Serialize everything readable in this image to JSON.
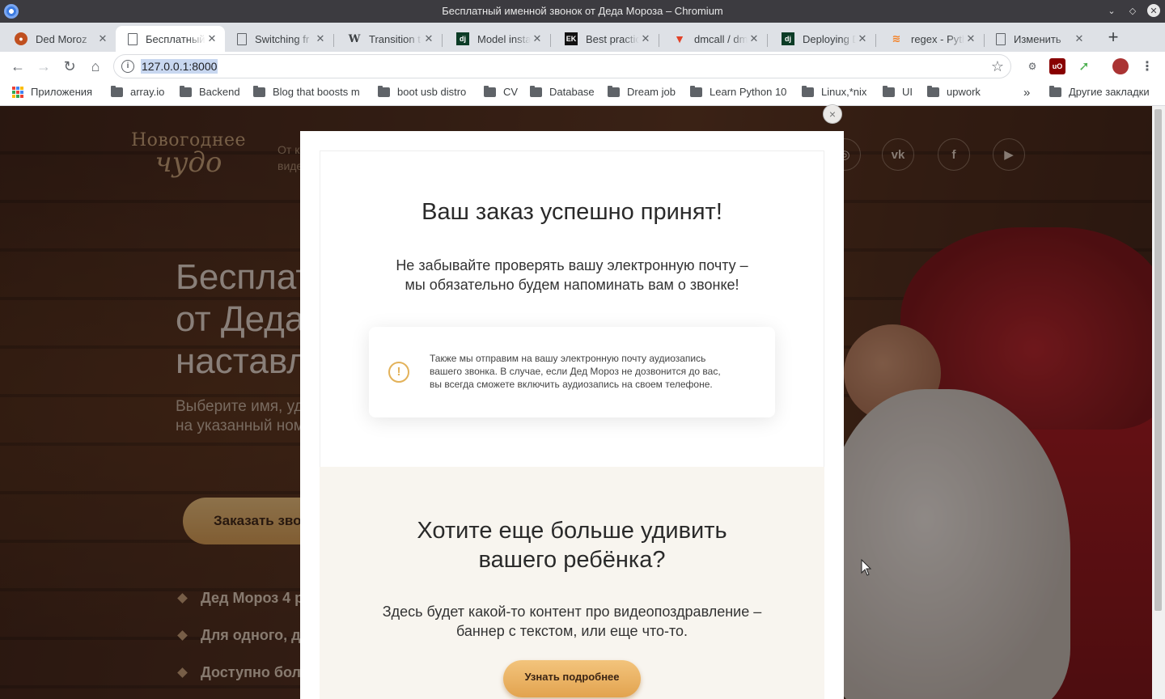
{
  "window": {
    "title": "Бесплатный именной звонок от Деда Мороза – Chromium"
  },
  "tabs": [
    {
      "label": "Ded Moroz",
      "favicon": "ded-moroz-icon"
    },
    {
      "label": "Бесплатный",
      "favicon": "page-icon",
      "active": true
    },
    {
      "label": "Switching fr",
      "favicon": "page-icon"
    },
    {
      "label": "Transition t",
      "favicon": "wikipedia-icon"
    },
    {
      "label": "Model insta",
      "favicon": "django-icon"
    },
    {
      "label": "Best practic",
      "favicon": "ek-icon"
    },
    {
      "label": "dmcall / dm",
      "favicon": "gitlab-icon"
    },
    {
      "label": "Deploying D",
      "favicon": "django-icon"
    },
    {
      "label": "regex - Pyth",
      "favicon": "stackoverflow-icon"
    },
    {
      "label": "Изменить",
      "favicon": "page-icon"
    }
  ],
  "toolbar": {
    "url": "127.0.0.1:8000"
  },
  "bookmarks": {
    "apps": "Приложения",
    "items": [
      "array.io",
      "Backend",
      "Blog that boosts m",
      "boot usb distro",
      "CV",
      "Database",
      "Dream job",
      "Learn Python 10",
      "Linux,*nix",
      "UI",
      "upwork"
    ],
    "other": "Другие закладки",
    "overflow": "»"
  },
  "site": {
    "logo_line1": "Новогоднее",
    "logo_line2": "чудо",
    "tagline": "От к\nвиде",
    "social": [
      "instagram-icon",
      "vk-icon",
      "facebook-icon",
      "youtube-icon"
    ],
    "hero_title": [
      "Бесплат",
      "от Деда",
      "наставл"
    ],
    "hero_sub": [
      "Выберите имя, удо",
      "на указанный номе"
    ],
    "cta": "Заказать звон",
    "features": [
      "Дед Мороз 4 р",
      "Для одного, д",
      "Доступно боле"
    ]
  },
  "modal": {
    "title": "Ваш заказ успешно принят!",
    "text_line1": "Не забывайте проверять вашу электронную почту –",
    "text_line2": "мы обязательно будем напоминать вам о звонке!",
    "note_line1": "Также мы отправим на вашу электронную почту аудиозапись",
    "note_line2": "вашего звонка. В случае, если Дед Мороз не дозвонится до вас,",
    "note_line3": "вы всегда сможете включить аудиозапись на своем телефоне.",
    "promo_title_line1": "Хотите еще больше удивить",
    "promo_title_line2": "вашего ребёнка?",
    "promo_text_line1": "Здесь будет какой-то контент про видеопоздравление –",
    "promo_text_line2": "баннер с текстом, или еще что-то.",
    "more_button": "Узнать подробнее",
    "close": "×"
  },
  "colors": {
    "accent": "#e2a34f",
    "page_bg": "#4a2b1c",
    "tab_strip": "#dee1e6"
  }
}
